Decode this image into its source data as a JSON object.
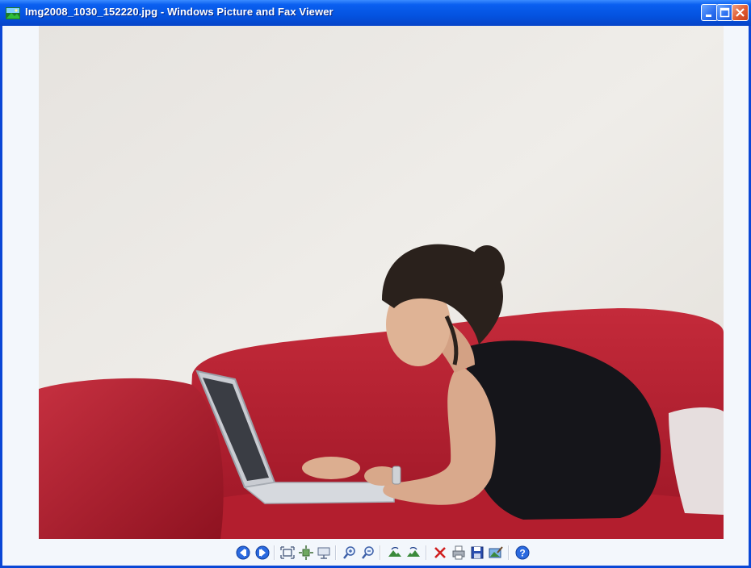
{
  "window": {
    "title": "Img2008_1030_152220.jpg - Windows Picture and Fax Viewer",
    "accent_color": "#0453e0",
    "close_color": "#e05a30"
  },
  "caption_buttons": [
    "minimize-icon",
    "maximize-icon",
    "close-icon"
  ],
  "viewer": {
    "photo_description_icon": "photo-image"
  },
  "toolbar": {
    "buttons": [
      {
        "name": "previous-image-button",
        "icon": "previous-icon"
      },
      {
        "name": "next-image-button",
        "icon": "next-icon"
      },
      {
        "name": "best-fit-button",
        "icon": "best-fit-icon"
      },
      {
        "name": "actual-size-button",
        "icon": "actual-size-icon"
      },
      {
        "name": "slide-show-button",
        "icon": "slide-show-icon"
      },
      {
        "name": "zoom-in-button",
        "icon": "zoom-in-icon"
      },
      {
        "name": "zoom-out-button",
        "icon": "zoom-out-icon"
      },
      {
        "name": "rotate-clockwise-button",
        "icon": "rotate-clockwise-icon"
      },
      {
        "name": "rotate-counterclockwise-button",
        "icon": "rotate-counterclockwise-icon"
      },
      {
        "name": "delete-button",
        "icon": "delete-icon"
      },
      {
        "name": "print-button",
        "icon": "print-icon"
      },
      {
        "name": "copy-to-button",
        "icon": "save-icon"
      },
      {
        "name": "edit-button",
        "icon": "edit-image-icon"
      },
      {
        "name": "help-button",
        "icon": "help-icon"
      }
    ]
  }
}
